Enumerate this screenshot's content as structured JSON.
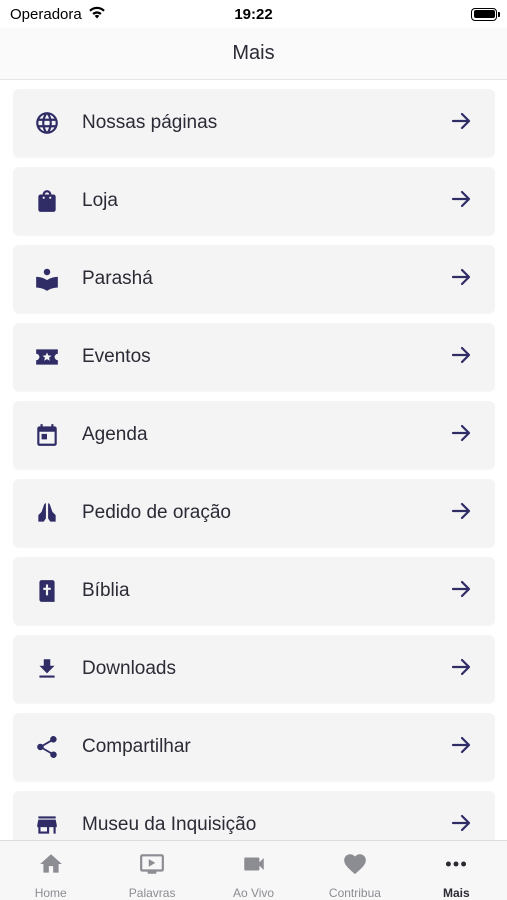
{
  "status": {
    "carrier": "Operadora",
    "time": "19:22"
  },
  "header": {
    "title": "Mais"
  },
  "menu": {
    "items": [
      {
        "label": "Nossas páginas",
        "icon": "globe-icon"
      },
      {
        "label": "Loja",
        "icon": "shopping-bag-icon"
      },
      {
        "label": "Parashá",
        "icon": "reading-book-icon"
      },
      {
        "label": "Eventos",
        "icon": "ticket-star-icon"
      },
      {
        "label": "Agenda",
        "icon": "calendar-icon"
      },
      {
        "label": "Pedido de oração",
        "icon": "praying-hands-icon"
      },
      {
        "label": "Bíblia",
        "icon": "bible-icon"
      },
      {
        "label": "Downloads",
        "icon": "download-icon"
      },
      {
        "label": "Compartilhar",
        "icon": "share-icon"
      },
      {
        "label": "Museu da Inquisição",
        "icon": "storefront-icon"
      }
    ]
  },
  "tabs": [
    {
      "label": "Home",
      "icon": "home-icon",
      "active": false
    },
    {
      "label": "Palavras",
      "icon": "video-player-icon",
      "active": false
    },
    {
      "label": "Ao Vivo",
      "icon": "camera-icon",
      "active": false
    },
    {
      "label": "Contribua",
      "icon": "heart-icon",
      "active": false
    },
    {
      "label": "Mais",
      "icon": "more-dots-icon",
      "active": true
    }
  ],
  "colors": {
    "accent": "#2f2c66",
    "item_background": "#f4f4f5",
    "inactive_tab": "#8c8c93"
  }
}
